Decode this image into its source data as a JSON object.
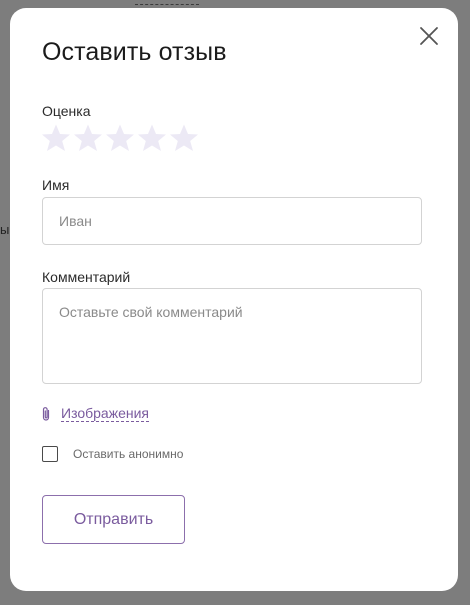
{
  "colors": {
    "accent": "#7a5b9e",
    "star_empty": "#ece9f5",
    "overlay": "#7d7d7d"
  },
  "background": {
    "partial_text": "ы"
  },
  "modal": {
    "title": "Оставить отзыв",
    "close_icon": "close-icon",
    "rating": {
      "label": "Оценка",
      "max_stars": 5,
      "value": 0,
      "star_icon": "star-icon"
    },
    "name": {
      "label": "Имя",
      "placeholder": "Иван",
      "value": ""
    },
    "comment": {
      "label": "Комментарий",
      "placeholder": "Оставьте свой комментарий",
      "value": ""
    },
    "attach": {
      "icon": "paperclip-icon",
      "label": "Изображения"
    },
    "anonymous": {
      "label": "Оставить анонимно",
      "checked": false
    },
    "submit_label": "Отправить"
  }
}
